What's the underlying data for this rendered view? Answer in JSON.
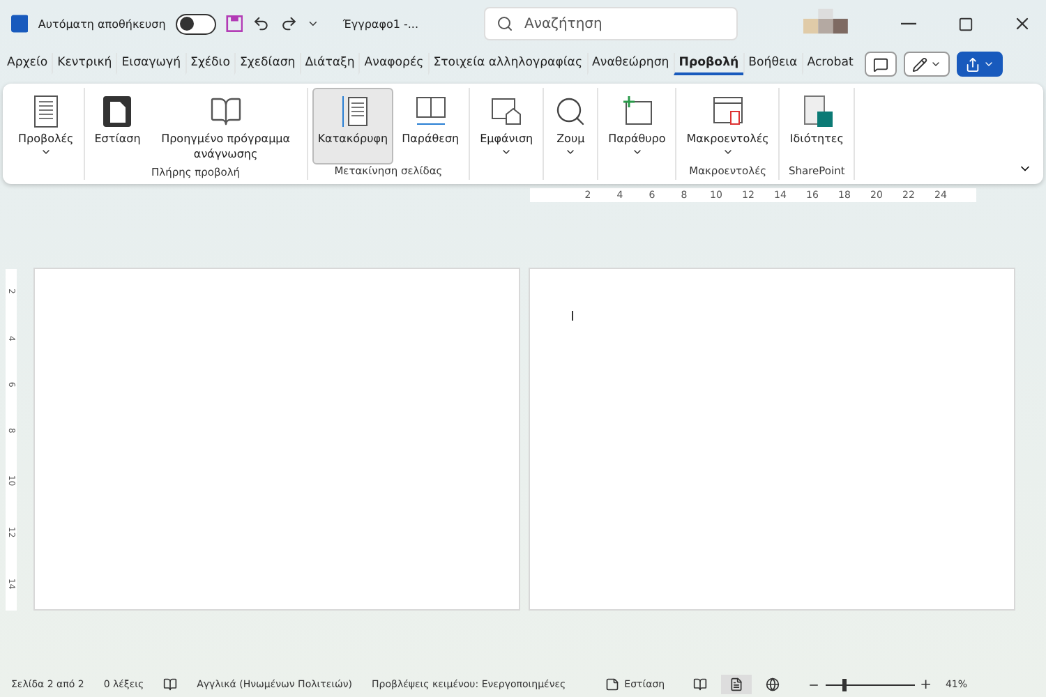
{
  "titlebar": {
    "autosave_label": "Αυτόματη αποθήκευση",
    "autosave_on": false,
    "document": "Έγγραφο1 -...",
    "search_placeholder": "Αναζήτηση"
  },
  "tabs": [
    {
      "label": "Αρχείο",
      "selected": false
    },
    {
      "label": "Κεντρική",
      "selected": false
    },
    {
      "label": "Εισαγωγή",
      "selected": false
    },
    {
      "label": "Σχέδιο",
      "selected": false
    },
    {
      "label": "Σχεδίαση",
      "selected": false
    },
    {
      "label": "Διάταξη",
      "selected": false
    },
    {
      "label": "Αναφορές",
      "selected": false
    },
    {
      "label": "Στοιχεία αλληλογραφίας",
      "selected": false
    },
    {
      "label": "Αναθεώρηση",
      "selected": false
    },
    {
      "label": "Προβολή",
      "selected": true
    },
    {
      "label": "Βοήθεια",
      "selected": false
    },
    {
      "label": "Acrobat",
      "selected": false
    }
  ],
  "ribbon_groups": [
    {
      "buttons": [
        {
          "kind": "views",
          "label": "Προβολές",
          "dropdown": true,
          "selected": false
        }
      ]
    },
    {
      "label": "Πλήρης προβολή",
      "buttons": [
        {
          "kind": "focus",
          "label": "Εστίαση",
          "dropdown": false,
          "selected": false
        },
        {
          "kind": "reader",
          "label": "Προηγμένο πρόγραμμα ανάγνωσης",
          "dropdown": false,
          "selected": false
        }
      ]
    },
    {
      "label": "Μετακίνηση σελίδας",
      "buttons": [
        {
          "kind": "vertical",
          "label": "Κατακόρυφη",
          "dropdown": false,
          "selected": true
        },
        {
          "kind": "side",
          "label": "Παράθεση",
          "dropdown": false,
          "selected": false
        }
      ]
    },
    {
      "buttons": [
        {
          "kind": "show",
          "label": "Εμφάνιση",
          "dropdown": true,
          "selected": false
        }
      ]
    },
    {
      "buttons": [
        {
          "kind": "zoom",
          "label": "Ζουμ",
          "dropdown": true,
          "selected": false
        }
      ]
    },
    {
      "buttons": [
        {
          "kind": "window",
          "label": "Παράθυρο",
          "dropdown": true,
          "selected": false
        }
      ]
    },
    {
      "label": "Μακροεντολές",
      "buttons": [
        {
          "kind": "macros",
          "label": "Μακροεντολές",
          "dropdown": true,
          "selected": false
        }
      ]
    },
    {
      "label": "SharePoint",
      "buttons": [
        {
          "kind": "properties",
          "label": "Ιδιότητες",
          "dropdown": false,
          "selected": false
        }
      ]
    }
  ],
  "ruler": {
    "horizontal": [
      "2",
      "4",
      "6",
      "8",
      "10",
      "12",
      "14",
      "16",
      "18",
      "20",
      "22",
      "24"
    ],
    "vertical": [
      "2",
      "4",
      "6",
      "8",
      "10",
      "12",
      "14"
    ]
  },
  "status_bar": {
    "page": "Σελίδα 2 από 2",
    "words": "0 λέξεις",
    "language": "Αγγλικά (Ηνωμένων Πολιτειών)",
    "predictions": "Προβλέψεις κειμένου: Ενεργοποιημένες",
    "focus": "Εστίαση",
    "views": [
      {
        "kind": "read",
        "selected": false
      },
      {
        "kind": "print",
        "selected": true
      },
      {
        "kind": "web",
        "selected": false
      }
    ],
    "zoom_slider": {
      "level": 0.2
    },
    "zoom_in": "+",
    "zoom": "41%"
  }
}
